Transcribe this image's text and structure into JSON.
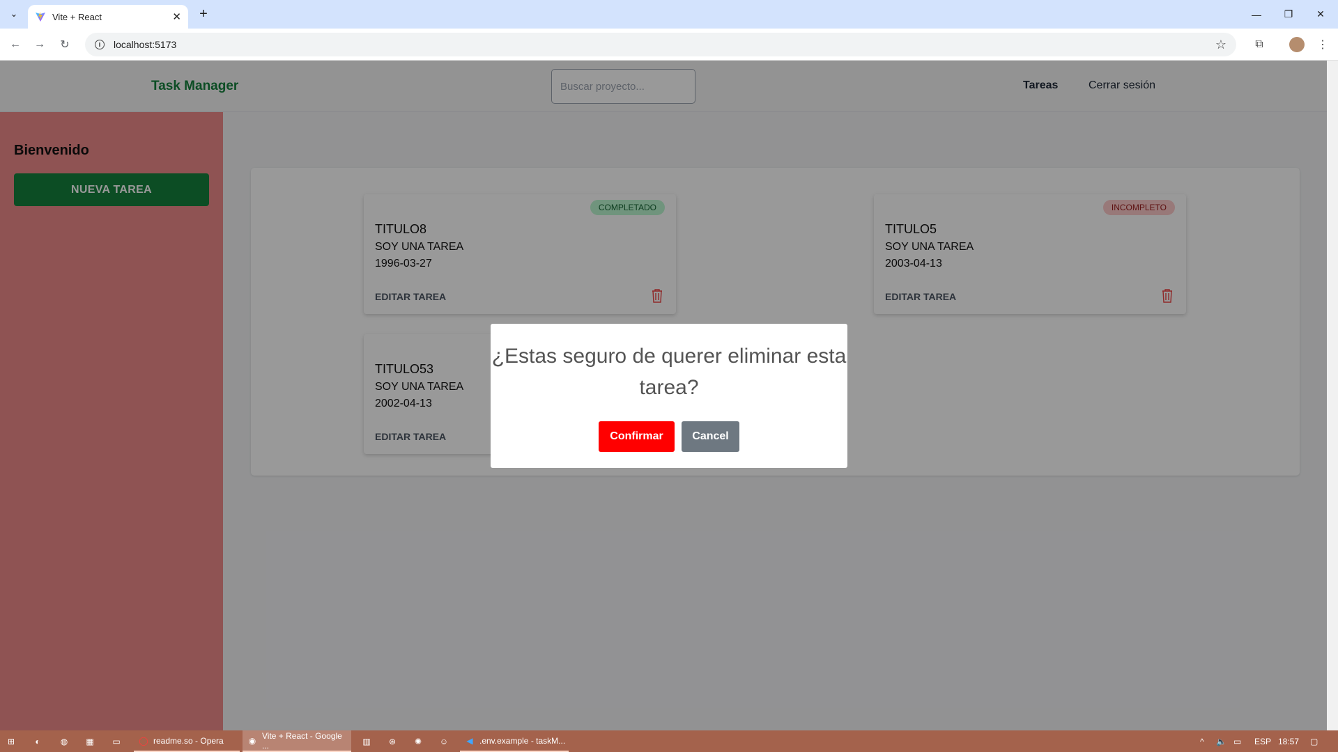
{
  "browser": {
    "tab_title": "Vite + React",
    "url": "localhost:5173"
  },
  "app": {
    "brand": "Task Manager",
    "search_placeholder": "Buscar proyecto...",
    "nav": {
      "tasks": "Tareas",
      "logout": "Cerrar sesión"
    },
    "sidebar": {
      "welcome": "Bienvenido",
      "new_task": "NUEVA TAREA"
    },
    "tasks": [
      {
        "title": "TITULO8",
        "description": "SOY UNA TAREA",
        "date": "1996-03-27",
        "status": "COMPLETADO",
        "edit": "EDITAR TAREA"
      },
      {
        "title": "TITULO5",
        "description": "SOY UNA TAREA",
        "date": "2003-04-13",
        "status": "INCOMPLETO",
        "edit": "EDITAR TAREA"
      },
      {
        "title": "TITULO53",
        "description": "SOY UNA TAREA",
        "date": "2002-04-13",
        "status": "",
        "edit": "EDITAR TAREA"
      }
    ]
  },
  "dialog": {
    "title": "¿Estas seguro de querer eliminar esta tarea?",
    "confirm": "Confirmar",
    "cancel": "Cancel"
  },
  "taskbar": {
    "apps": [
      {
        "label": "readme.so - Opera"
      },
      {
        "label": "Vite + React - Google ..."
      },
      {
        "label": ".env.example - taskM..."
      }
    ],
    "lang": "ESP",
    "time": "18:57"
  },
  "colors": {
    "brand_green": "#15803d",
    "sidebar_bg": "#ee8a8a",
    "confirm_red": "#ff0000",
    "cancel_gray": "#6e7881"
  }
}
